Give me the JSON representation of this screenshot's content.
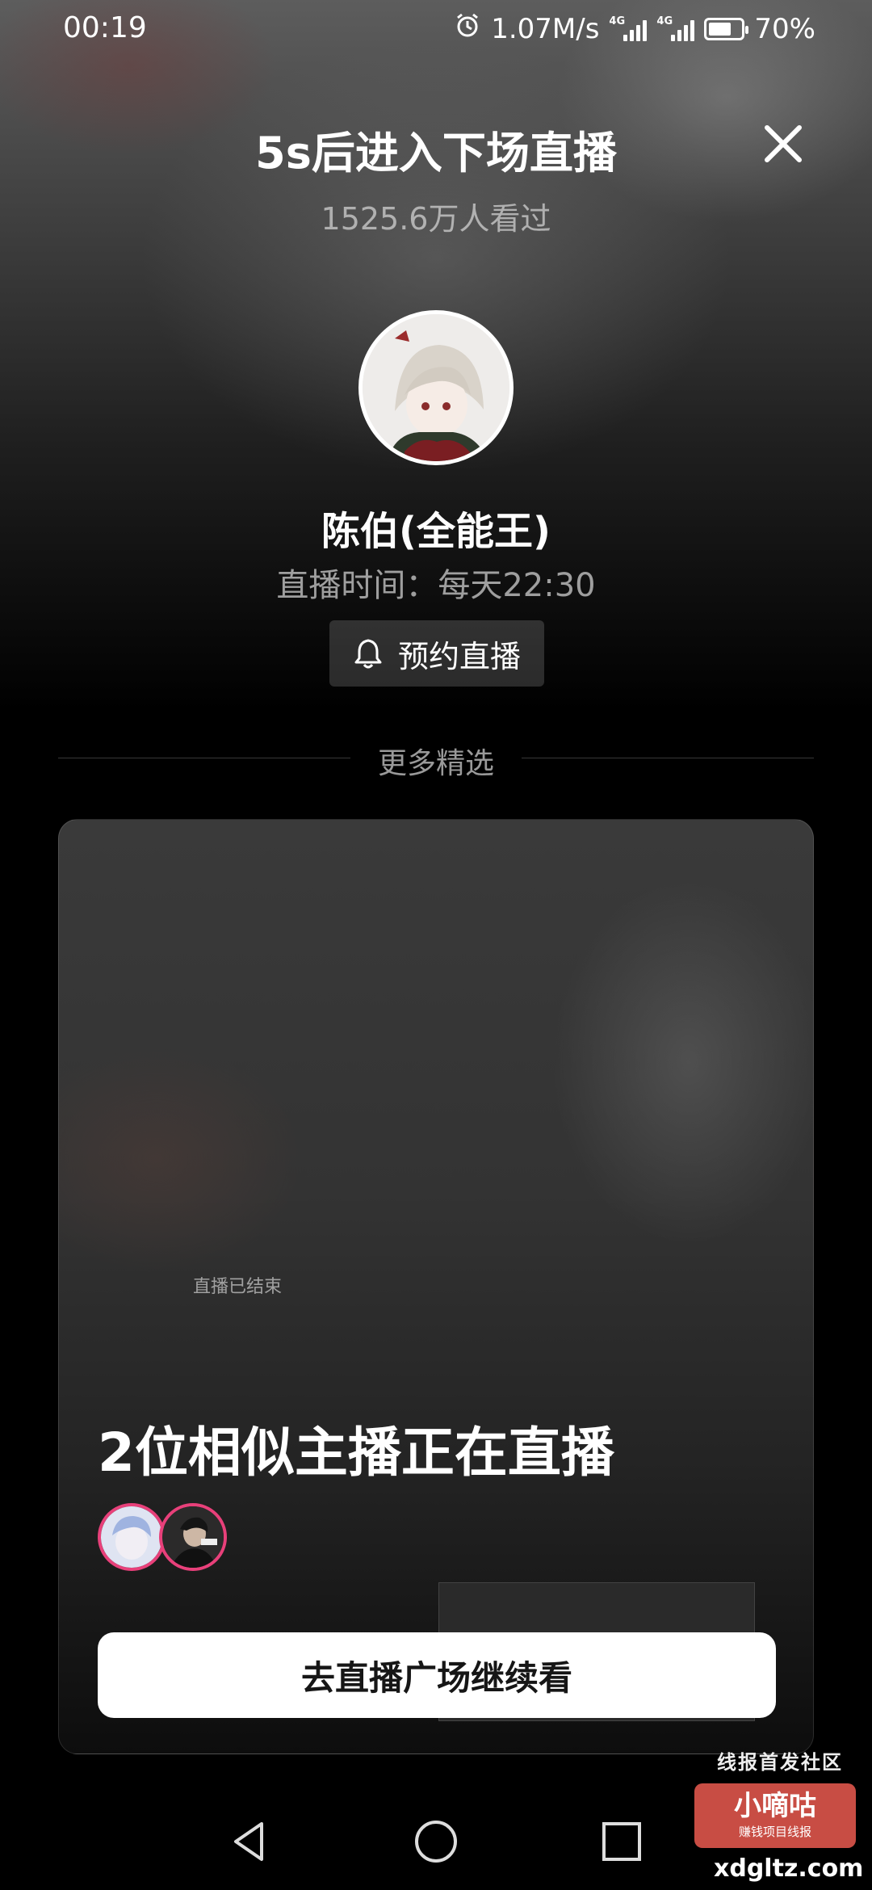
{
  "status_bar": {
    "time": "00:19",
    "net_speed": "1.07M/s",
    "sim1_label": "4G",
    "sim2_label": "4G",
    "battery_pct": "70%",
    "battery_level": 0.7
  },
  "header": {
    "title": "5s后进入下场直播",
    "views": "1525.6万人看过"
  },
  "host": {
    "name": "陈伯(全能王)",
    "live_time": "直播时间：每天22:30",
    "reserve_label": "预约直播"
  },
  "more": {
    "divider_label": "更多精选"
  },
  "card": {
    "ended_text": "直播已结束",
    "similar_text": "2位相似主播正在直播",
    "button_label": "去直播广场继续看"
  },
  "watermark": {
    "text": "线报首发社区",
    "logo_text": "小嘀咕",
    "logo_sub": "赚钱项目线报",
    "url": "xdgltz.com"
  },
  "colors": {
    "accent_ring": "#e8407a",
    "button_bg": "#ffffff",
    "button_text": "#161616"
  },
  "icons": [
    "alarm-icon",
    "signal-icon",
    "battery-icon",
    "close-icon",
    "bell-icon",
    "back-icon",
    "home-icon",
    "recents-icon"
  ]
}
